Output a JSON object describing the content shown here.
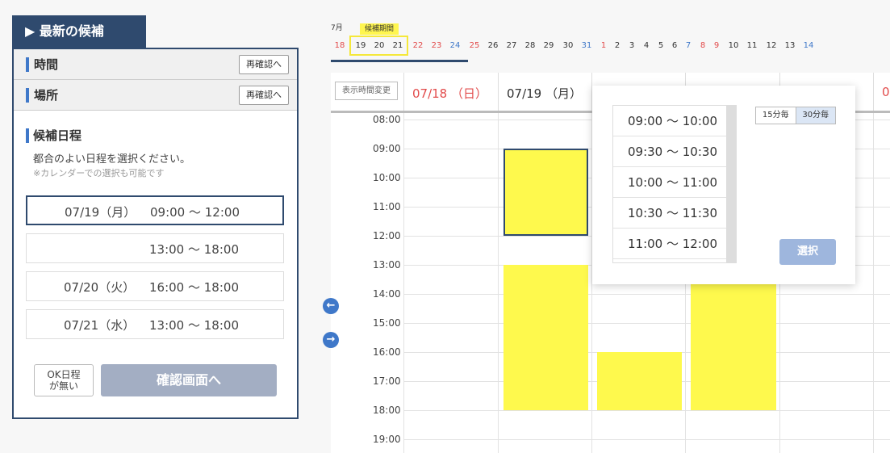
{
  "panel": {
    "tab_title": "▶ 最新の候補",
    "time_label": "時間",
    "place_label": "場所",
    "recheck_label": "再確認へ",
    "candidates_title": "候補日程",
    "instruction": "都合のよい日程を選択ください。",
    "note": "※カレンダーでの選択も可能です",
    "slots": [
      {
        "date": "07/19（月）",
        "time": "09:00 〜 12:00",
        "selected": true
      },
      {
        "date": "",
        "time": "13:00 〜 18:00",
        "selected": false
      },
      {
        "date": "07/20（火）",
        "time": "16:00 〜 18:00",
        "selected": false
      },
      {
        "date": "07/21（水）",
        "time": "13:00 〜 18:00",
        "selected": false
      }
    ],
    "ok_button_line1": "OK日程",
    "ok_button_line2": "が無い",
    "confirm_button": "確認画面へ"
  },
  "date_strip": {
    "month": "7月",
    "period_label": "候補期間",
    "days": [
      {
        "label": "18",
        "color": "red"
      },
      {
        "label": "19",
        "color": ""
      },
      {
        "label": "20",
        "color": ""
      },
      {
        "label": "21",
        "color": ""
      },
      {
        "label": "22",
        "color": "red"
      },
      {
        "label": "23",
        "color": "red"
      },
      {
        "label": "24",
        "color": "blue"
      },
      {
        "label": "25",
        "color": "red"
      },
      {
        "label": "26",
        "color": ""
      },
      {
        "label": "27",
        "color": ""
      },
      {
        "label": "28",
        "color": ""
      },
      {
        "label": "29",
        "color": ""
      },
      {
        "label": "30",
        "color": ""
      },
      {
        "label": "31",
        "color": "blue"
      },
      {
        "label": "1",
        "color": "red"
      },
      {
        "label": "2",
        "color": ""
      },
      {
        "label": "3",
        "color": ""
      },
      {
        "label": "4",
        "color": ""
      },
      {
        "label": "5",
        "color": ""
      },
      {
        "label": "6",
        "color": ""
      },
      {
        "label": "7",
        "color": "blue"
      },
      {
        "label": "8",
        "color": "red"
      },
      {
        "label": "9",
        "color": "red"
      },
      {
        "label": "10",
        "color": ""
      },
      {
        "label": "11",
        "color": ""
      },
      {
        "label": "12",
        "color": ""
      },
      {
        "label": "13",
        "color": ""
      },
      {
        "label": "14",
        "color": "blue"
      }
    ]
  },
  "calendar": {
    "view_button": "表示時間変更",
    "columns": [
      {
        "title": "07/18 （日）",
        "color": "#e24b4b"
      },
      {
        "title": "07/19 （月）",
        "color": "#333333"
      },
      {
        "title": "",
        "color": "#333333"
      },
      {
        "title": "",
        "color": "#333333"
      },
      {
        "title": "",
        "color": "#333333"
      },
      {
        "title": "0",
        "color": "#e24b4b"
      }
    ],
    "times": [
      "08:00",
      "09:00",
      "10:00",
      "11:00",
      "12:00",
      "13:00",
      "14:00",
      "15:00",
      "16:00",
      "17:00",
      "18:00",
      "19:00"
    ],
    "blocks": [
      {
        "col": 1,
        "start": "09:00",
        "end": "12:00",
        "selected": true
      },
      {
        "col": 1,
        "start": "13:00",
        "end": "18:00",
        "selected": false
      },
      {
        "col": 2,
        "start": "16:00",
        "end": "18:00",
        "selected": false
      },
      {
        "col": 3,
        "start": "13:00",
        "end": "18:00",
        "selected": false
      }
    ]
  },
  "popup": {
    "options": [
      "09:00 〜 10:00",
      "09:30 〜 10:30",
      "10:00 〜 11:00",
      "10:30 〜 11:30",
      "11:00 〜 12:00"
    ],
    "interval_15": "15分毎",
    "interval_30": "30分毎",
    "interval_selected": "30分毎",
    "select_button": "選択"
  },
  "colors": {
    "navy": "#2f4a6e",
    "accent_blue": "#3f78c9",
    "slot_yellow": "#fef94d",
    "sunday_red": "#e24b4b"
  }
}
